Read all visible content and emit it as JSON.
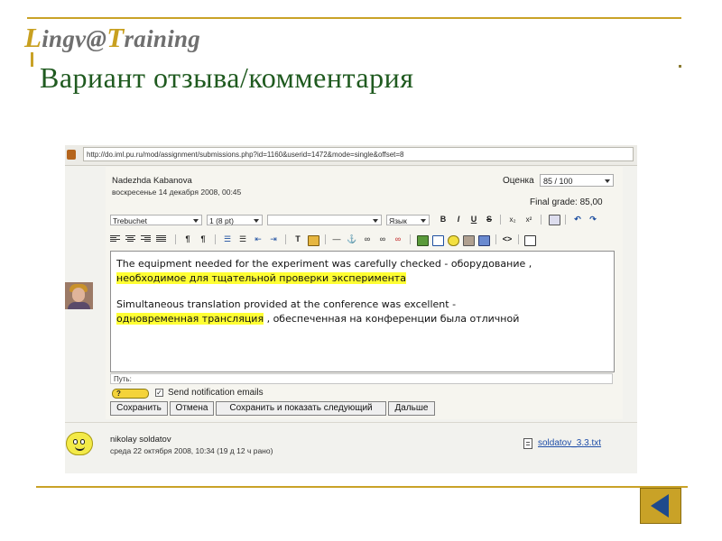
{
  "slide": {
    "logo": {
      "cap1": "L",
      "rest1": "ingv@",
      "cap2": "T",
      "rest2": "raining"
    },
    "title": "Вариант отзыва/комментария"
  },
  "colors": {
    "accent": "#c9a227",
    "title": "#1f5a1f",
    "highlight": "#ffff33",
    "link": "#1f4ea8"
  },
  "browser": {
    "url": "http://do.iml.pu.ru/mod/assignment/submissions.php?id=1160&userid=1472&mode=single&offset=8"
  },
  "submission": {
    "student_name": "Nadezhda Kabanova",
    "date": "воскресенье 14 декабря 2008, 00:45",
    "grade_label": "Оценка",
    "grade_value": "85 / 100",
    "final_grade": "Final grade: 85,00"
  },
  "editor": {
    "font_family": "Trebuchet",
    "font_size": "1 (8 pt)",
    "format": "",
    "language": "Язык",
    "buttons": {
      "bold": "B",
      "italic": "I",
      "underline": "U",
      "strike": "S",
      "subscript": "x₂",
      "superscript": "x²",
      "ltr": "¶",
      "rtl": "¶",
      "code": "<>"
    },
    "paragraph1_en": "The equipment needed for the experiment was carefully checked - оборудование ,",
    "paragraph1_ru_highlight": "необходимое для тщательной проверки эксперимента",
    "paragraph2_en": "Simultaneous translation provided at the conference was excellent -",
    "paragraph2_ru_highlight": "одновременная трансляция",
    "paragraph2_ru_rest": " , обеспеченная на конференции была отличной",
    "path_label": "Путь:"
  },
  "controls": {
    "help_label": "?",
    "checkbox_mark": "✓",
    "send_notification": "Send notification emails",
    "save": "Сохранить",
    "cancel": "Отмена",
    "save_and_next": "Сохранить и показать следующий",
    "next": "Дальше"
  },
  "next_submission": {
    "student_name": "nikolay soldatov",
    "date": "среда 22 октября 2008, 10:34 (19 д 12 ч рано)",
    "file": "soldatov_3.3.txt"
  },
  "icons": [
    "back-arrow-icon",
    "align-left-icon",
    "align-center-icon",
    "align-right-icon",
    "justify-icon",
    "list-ordered-icon",
    "list-bullet-icon",
    "outdent-icon",
    "indent-icon",
    "text-color-icon",
    "bg-color-icon",
    "horizontal-rule-icon",
    "anchor-icon",
    "link-icon",
    "unlink-icon",
    "image-icon",
    "table-icon",
    "smiley-icon",
    "spellcheck-icon",
    "html-source-icon",
    "fullscreen-icon",
    "file-txt-icon"
  ]
}
